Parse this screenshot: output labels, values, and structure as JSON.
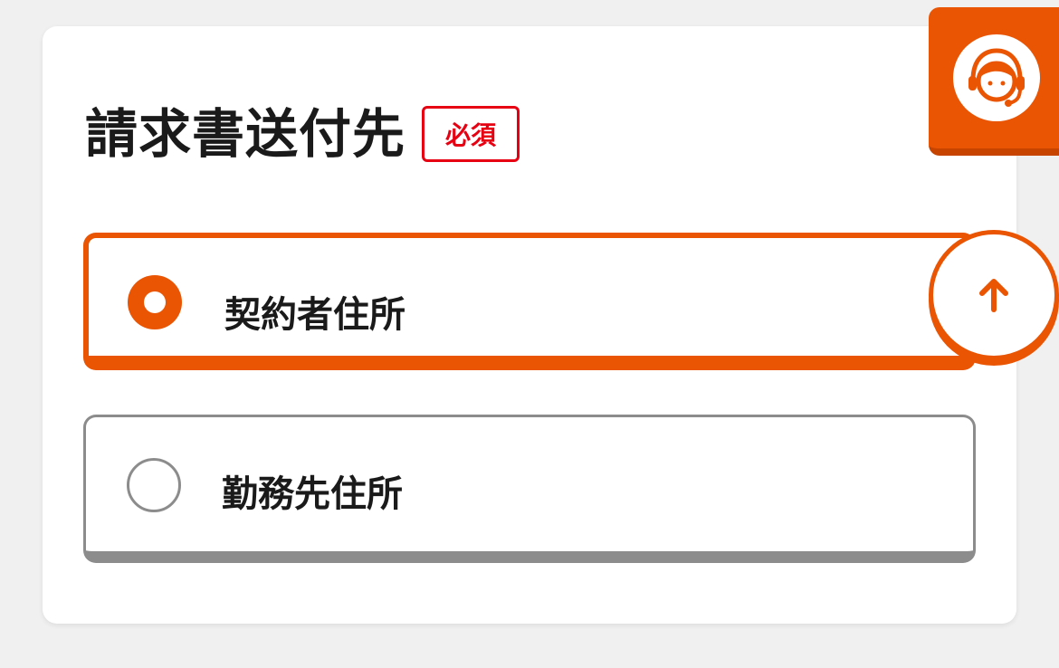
{
  "section": {
    "title": "請求書送付先",
    "required_badge": "必須"
  },
  "options": [
    {
      "label": "契約者住所",
      "selected": true
    },
    {
      "label": "勤務先住所",
      "selected": false
    }
  ],
  "floating": {
    "support_icon": "operator-headset-icon",
    "scroll_top_icon": "arrow-up-icon"
  },
  "colors": {
    "accent": "#ea5504",
    "required": "#e60012",
    "border_unselected": "#8c8c8c",
    "background": "#f0f0f0",
    "card": "#ffffff"
  }
}
